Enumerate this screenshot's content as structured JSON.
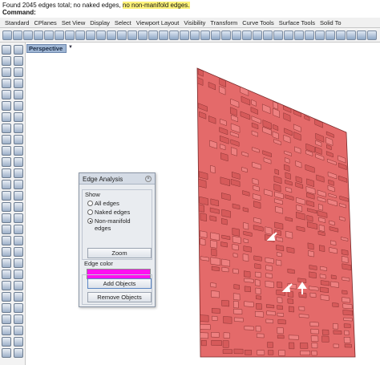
{
  "command": {
    "status_prefix": "Found 2045 edges total; no naked edges,",
    "status_highlight": "no non-manifold edges.",
    "prompt_label": "Command:"
  },
  "tabs": [
    "Standard",
    "CPlanes",
    "Set View",
    "Display",
    "Select",
    "Viewport Layout",
    "Visibility",
    "Transform",
    "Curve Tools",
    "Surface Tools",
    "Solid To"
  ],
  "viewport": {
    "label": "Perspective",
    "mesh_color": "#e46a6a"
  },
  "edge_analysis": {
    "title": "Edge Analysis",
    "show_label": "Show",
    "options": [
      {
        "label": "All edges",
        "selected": false
      },
      {
        "label": "Naked edges",
        "selected": false
      },
      {
        "label": "Non-manifold",
        "selected": true
      }
    ],
    "option_suffix": "edges",
    "zoom": "Zoom",
    "color_label": "Edge color",
    "color": "#ff10f0",
    "add_objects": "Add Objects",
    "remove_objects": "Remove Objects"
  }
}
